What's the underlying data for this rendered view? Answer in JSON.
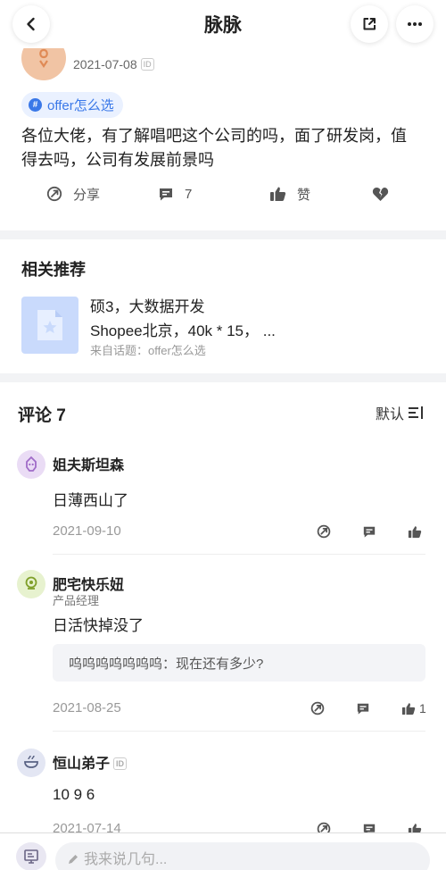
{
  "header": {
    "title": "脉脉"
  },
  "post": {
    "date": "2021-07-08",
    "id_badge": "ID",
    "topic_tag": "offer怎么选",
    "content": "各位大佬，有了解唱吧这个公司的吗，面了研发岗，值得去吗，公司有发展前景吗",
    "actions": {
      "share_label": "分享",
      "comment_count": "7",
      "like_label": "赞"
    }
  },
  "related": {
    "title": "相关推荐",
    "item": {
      "title": "硕3，大数据开发",
      "subtitle": "Shopee北京，40k * 15，  ...",
      "source": "来自话题：offer怎么选"
    }
  },
  "comments": {
    "header": "评论 7",
    "sort_label": "默认",
    "items": [
      {
        "name": "姐夫斯坦森",
        "text": "日薄西山了",
        "date": "2021-09-10"
      },
      {
        "name": "肥宅快乐妞",
        "role": "产品经理",
        "text": "日活快掉没了",
        "reply": "呜呜呜呜呜呜呜：现在还有多少?",
        "date": "2021-08-25",
        "likes": "1"
      },
      {
        "name": "恒山弟子",
        "id_badge": "ID",
        "text": "10 9 6",
        "date": "2021-07-14"
      }
    ]
  },
  "input": {
    "placeholder": "我来说几句..."
  },
  "colors": {
    "accent": "#3a78e8",
    "tag_bg": "#eaf1ff",
    "thumb_bg": "#c9dafc",
    "page_bg": "#f2f3f5"
  }
}
